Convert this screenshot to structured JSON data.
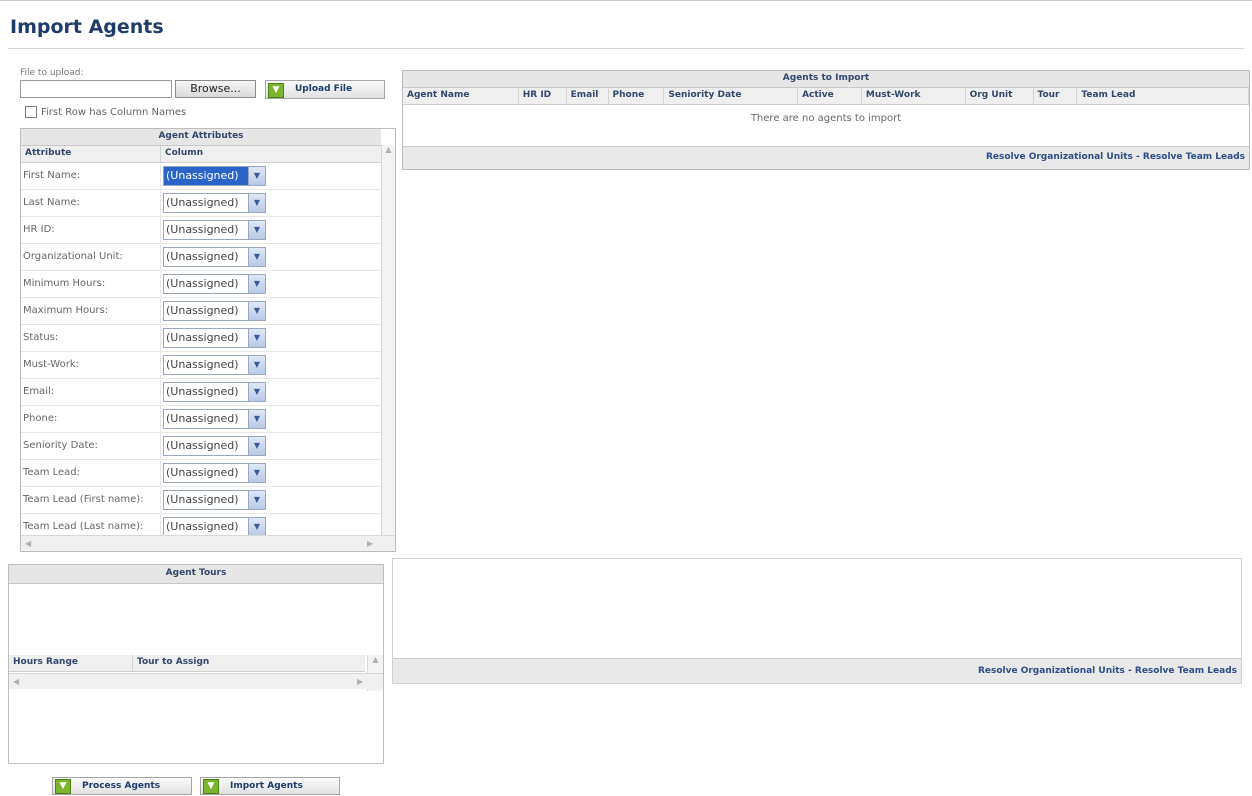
{
  "page": {
    "title": "Import Agents"
  },
  "upload": {
    "label": "File to upload:",
    "file_value": "",
    "browse_label": "Browse...",
    "upload_label": "Upload File",
    "first_row_label": "First Row has Column Names"
  },
  "attributes": {
    "title": "Agent Attributes",
    "col_attribute": "Attribute",
    "col_column": "Column",
    "rows": [
      {
        "name": "First Name:",
        "value": "(Unassigned)"
      },
      {
        "name": "Last Name:",
        "value": "(Unassigned)"
      },
      {
        "name": "HR ID:",
        "value": "(Unassigned)"
      },
      {
        "name": "Organizational Unit:",
        "value": "(Unassigned)"
      },
      {
        "name": "Minimum Hours:",
        "value": "(Unassigned)"
      },
      {
        "name": "Maximum Hours:",
        "value": "(Unassigned)"
      },
      {
        "name": "Status:",
        "value": "(Unassigned)"
      },
      {
        "name": "Must-Work:",
        "value": "(Unassigned)"
      },
      {
        "name": "Email:",
        "value": "(Unassigned)"
      },
      {
        "name": "Phone:",
        "value": "(Unassigned)"
      },
      {
        "name": "Seniority Date:",
        "value": "(Unassigned)"
      },
      {
        "name": "Team Lead:",
        "value": "(Unassigned)"
      },
      {
        "name": "Team Lead (First name):",
        "value": "(Unassigned)"
      },
      {
        "name": "Team Lead (Last name):",
        "value": "(Unassigned)"
      }
    ]
  },
  "agents": {
    "title": "Agents to Import",
    "columns": [
      "Agent Name",
      "HR ID",
      "Email",
      "Phone",
      "Seniority Date",
      "Active",
      "Must-Work",
      "Org Unit",
      "Tour",
      "Team Lead"
    ],
    "empty_message": "There are no agents to import",
    "resolve_org": "Resolve Organizational Units",
    "separator": "-",
    "resolve_team": "Resolve Team Leads"
  },
  "tours": {
    "title": "Agent Tours",
    "col_hours": "Hours Range",
    "col_tour": "Tour to Assign"
  },
  "actions": {
    "process_label": "Process Agents",
    "import_label": "Import Agents"
  },
  "colors": {
    "accent": "#1f3d6b",
    "link": "#2d4d89",
    "button_icon": "#7bb52e",
    "selection": "#2a64c9"
  }
}
